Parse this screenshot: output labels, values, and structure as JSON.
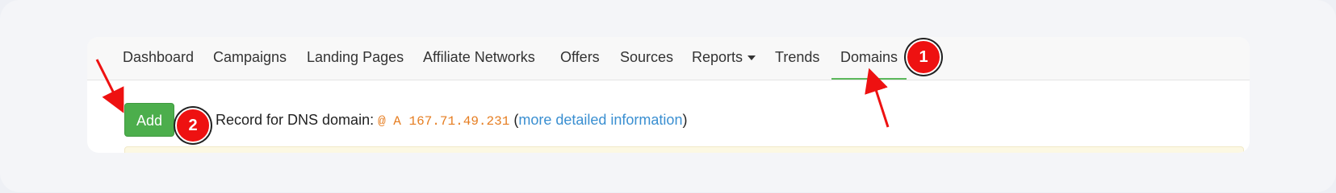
{
  "nav": {
    "items": [
      {
        "label": "Dashboard"
      },
      {
        "label": "Campaigns"
      },
      {
        "label": "Landing Pages"
      },
      {
        "label": "Affiliate Networks"
      },
      {
        "label": "Offers"
      },
      {
        "label": "Sources"
      },
      {
        "label": "Reports"
      },
      {
        "label": "Trends"
      },
      {
        "label": "Domains",
        "active": true
      }
    ]
  },
  "content": {
    "add_label": "Add",
    "record_prefix": "Record for DNS domain:",
    "record_value": "@ A 167.71.49.231",
    "open_paren": "(",
    "link_text": "more detailed information",
    "close_paren": ")"
  },
  "annotations": {
    "badge1": "1",
    "badge2": "2",
    "color": "#ee1111"
  }
}
